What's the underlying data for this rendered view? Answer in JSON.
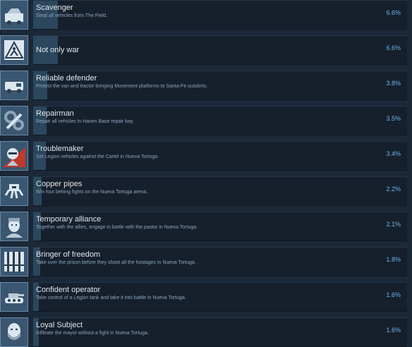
{
  "achievements": [
    {
      "title": "Scavenger",
      "description": "Steal all vehicles from The Field.",
      "percent": "6.6%",
      "icon": "wrecked-car-icon"
    },
    {
      "title": "Not only war",
      "description": "",
      "percent": "6.6%",
      "icon": "road-work-sign-icon"
    },
    {
      "title": "Reliable defender",
      "description": "Protect the van and tractor bringing Movement platforms to Santa-Fe outskirts.",
      "percent": "3.8%",
      "icon": "van-icon"
    },
    {
      "title": "Repairman",
      "description": "Repair all vehicles in Haven Base repair bay.",
      "percent": "3.5%",
      "icon": "wrench-gears-icon"
    },
    {
      "title": "Troublemaker",
      "description": "Set Legion vehicles against the Cartel in Nueva Tortuga.",
      "percent": "3.4%",
      "icon": "masked-face-icon"
    },
    {
      "title": "Copper pipes",
      "description": "Win four betting fights on the Nueva Tortuga arena.",
      "percent": "2.2%",
      "icon": "arena-machine-icon"
    },
    {
      "title": "Temporary alliance",
      "description": "Together with the allies, engage in battle with the pastor in Nueva Tortuga.",
      "percent": "2.1%",
      "icon": "face-portrait-icon"
    },
    {
      "title": "Bringer of freedom",
      "description": "Take over the prison before they shoot all the hostages in Nueva Tortuga.",
      "percent": "1.8%",
      "icon": "prison-bars-icon"
    },
    {
      "title": "Confident operator",
      "description": "Take control of a Legion tank and take it into battle in Nueva Tortuga.",
      "percent": "1.6%",
      "icon": "tank-icon"
    },
    {
      "title": "Loyal Subject",
      "description": "Infiltrate the mayor without a fight in Nueva Tortuga.",
      "percent": "1.6%",
      "icon": "bearded-face-icon"
    }
  ],
  "colors": {
    "fill": "#2b475e",
    "percent": "#6fb4e6",
    "troublemaker_accent": "#c0392b"
  }
}
